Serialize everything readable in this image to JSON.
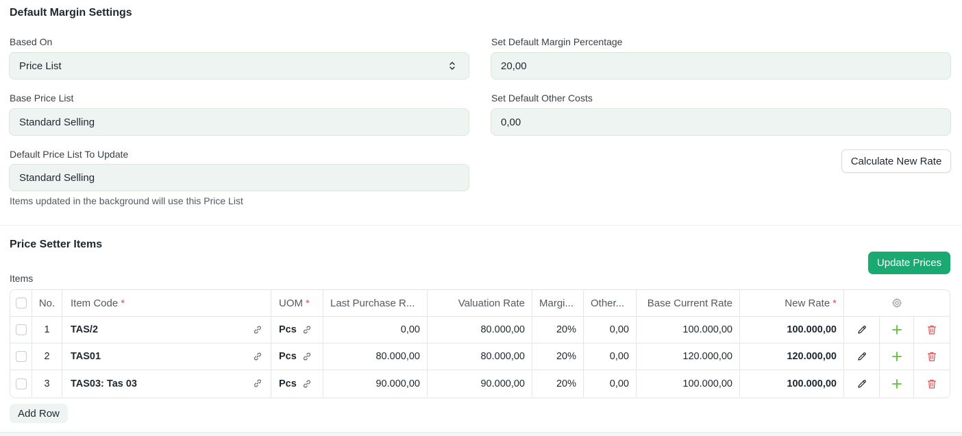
{
  "settings": {
    "title": "Default Margin Settings",
    "based_on": {
      "label": "Based On",
      "value": "Price List"
    },
    "margin_percentage": {
      "label": "Set Default Margin Percentage",
      "value": "20,00"
    },
    "base_price_list": {
      "label": "Base Price List",
      "value": "Standard Selling"
    },
    "other_costs": {
      "label": "Set Default Other Costs",
      "value": "0,00"
    },
    "price_list_to_update": {
      "label": "Default Price List To Update",
      "value": "Standard Selling",
      "help": "Items updated in the background will use this Price List"
    },
    "calculate_button": "Calculate New Rate"
  },
  "items_section": {
    "title": "Price Setter Items",
    "update_button": "Update Prices",
    "table_label": "Items",
    "columns": {
      "no": "No.",
      "item_code": "Item Code",
      "uom": "UOM",
      "last_purchase_rate": "Last Purchase R...",
      "valuation_rate": "Valuation Rate",
      "margin": "Margi...",
      "other": "Other...",
      "base_current_rate": "Base Current Rate",
      "new_rate": "New Rate",
      "required_mark": "*"
    },
    "rows": [
      {
        "no": "1",
        "item_code": "TAS/2",
        "uom": "Pcs",
        "last_purchase_rate": "0,00",
        "valuation_rate": "80.000,00",
        "margin": "20%",
        "other": "0,00",
        "base_current_rate": "100.000,00",
        "new_rate": "100.000,00"
      },
      {
        "no": "2",
        "item_code": "TAS01",
        "uom": "Pcs",
        "last_purchase_rate": "80.000,00",
        "valuation_rate": "80.000,00",
        "margin": "20%",
        "other": "0,00",
        "base_current_rate": "120.000,00",
        "new_rate": "120.000,00"
      },
      {
        "no": "3",
        "item_code": "TAS03: Tas 03",
        "uom": "Pcs",
        "last_purchase_rate": "90.000,00",
        "valuation_rate": "90.000,00",
        "margin": "20%",
        "other": "0,00",
        "base_current_rate": "100.000,00",
        "new_rate": "100.000,00"
      }
    ],
    "add_row_button": "Add Row"
  },
  "colors": {
    "primary": "#1aa971",
    "field_bg": "#edf4f1",
    "required": "#e24c4c",
    "add_icon": "#5bbf3a",
    "delete_icon": "#e24c4c"
  },
  "icons": [
    "select-arrows-icon",
    "link-icon",
    "gear-icon",
    "pencil-icon",
    "plus-icon",
    "trash-icon"
  ]
}
